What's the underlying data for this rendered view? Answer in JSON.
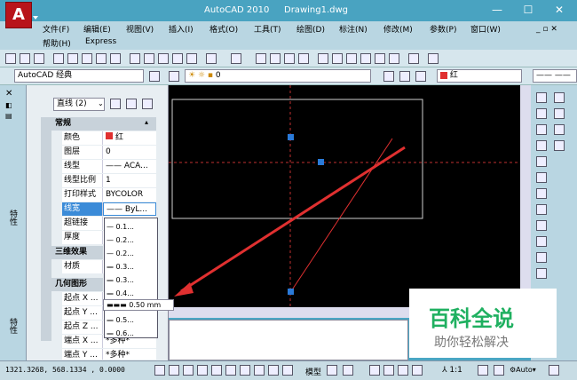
{
  "app": {
    "logo": "A",
    "title": "AutoCAD 2010",
    "document": "Drawing1.dwg"
  },
  "menu": [
    "文件(F)",
    "编辑(E)",
    "视图(V)",
    "插入(I)",
    "格式(O)",
    "工具(T)",
    "绘图(D)",
    "标注(N)",
    "修改(M)",
    "参数(P)",
    "窗口(W)"
  ],
  "menu_row2": [
    "帮助(H)",
    "Express"
  ],
  "toolbar2": {
    "workspace": "AutoCAD 经典",
    "layer": "0",
    "color": "红"
  },
  "properties": {
    "selection": "直线 (2)",
    "sections": {
      "general": "常规",
      "3d": "三维效果",
      "geometry": "几何图形"
    },
    "rows": [
      {
        "k": "颜色",
        "v": "红"
      },
      {
        "k": "图层",
        "v": "0"
      },
      {
        "k": "线型",
        "v": "—— ACA..."
      },
      {
        "k": "线型比例",
        "v": "1"
      },
      {
        "k": "打印样式",
        "v": "BYCOLOR"
      },
      {
        "k": "线宽",
        "v": "—— ByL..."
      },
      {
        "k": "超链接",
        "v": ""
      },
      {
        "k": "厚度",
        "v": ""
      }
    ],
    "rows3d": [
      {
        "k": "材质",
        "v": ""
      }
    ],
    "rowsgeo": [
      {
        "k": "起点 X ...",
        "v": ""
      },
      {
        "k": "起点 Y ...",
        "v": ""
      },
      {
        "k": "起点 Z ...",
        "v": ""
      },
      {
        "k": "端点 X ...",
        "v": "*多种*"
      },
      {
        "k": "端点 Y ...",
        "v": "*多种*"
      }
    ],
    "side_label": "特性"
  },
  "lineweight_options": [
    "0.1...",
    "0.2...",
    "0.2...",
    "0.3...",
    "0.3...",
    "0.4...",
    "0.50 mm",
    "0.5...",
    "0.6..."
  ],
  "status": {
    "coords": "1321.3268, 568.1334 , 0.0000",
    "model": "模型",
    "scale": "1:1",
    "auto": "Auto"
  },
  "watermark": {
    "title": "百科全说",
    "subtitle": "助你轻松解决"
  },
  "colors": {
    "red": "#e03030",
    "blue": "#2a7ad8"
  }
}
